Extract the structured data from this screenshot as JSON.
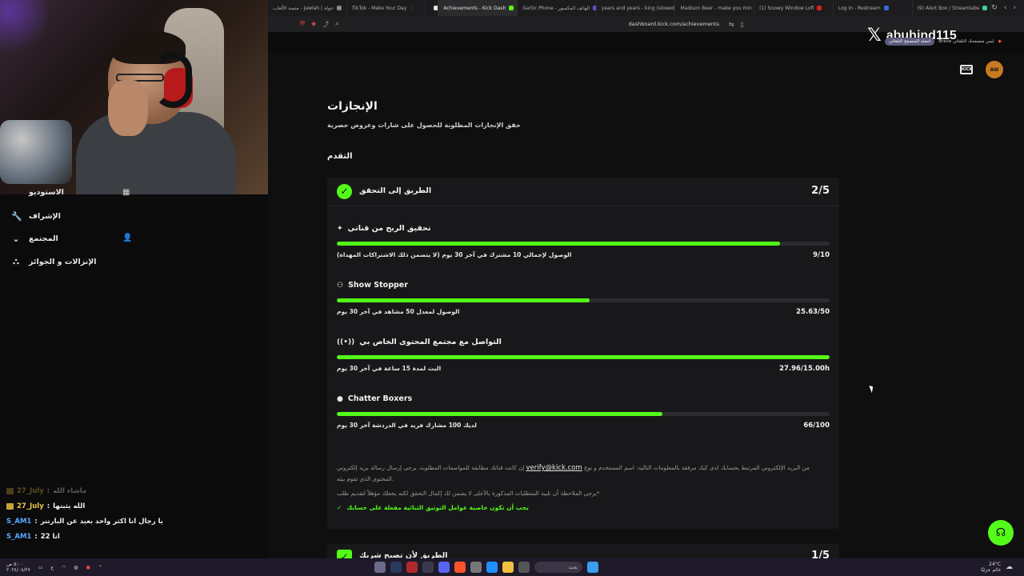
{
  "browser": {
    "tabs": [
      {
        "label": "متصة الألعاب - Jawlah | حولة",
        "color": "#888888"
      },
      {
        "label": "TikTok - Make Your Day",
        "color": "#222222"
      },
      {
        "label": "",
        "color": "#e0e0e0"
      },
      {
        "label": "Achievements - Kick Dash",
        "color": "#53fc18",
        "active": true
      },
      {
        "label": "Gartic Phone - الهاتف المكسور",
        "color": "#6a4ad1"
      },
      {
        "label": "years and years - king (slowed",
        "color": "#e02020"
      },
      {
        "label": "Madison Beer - make you min",
        "color": "#e02020"
      },
      {
        "label": "(1) Snowy Window Lofi",
        "color": "#e02020"
      },
      {
        "label": "Log In - Restream",
        "color": "#3a6ad1"
      },
      {
        "label": "(9) Alert Box / Streamlabs",
        "color": "#3fd1a0"
      }
    ],
    "url": "dashboard.kick.com/achievements"
  },
  "overlay": {
    "x_logo": "𝕏",
    "handle": "abuhind115",
    "brave_text": "Brave ليس متصفحك التلقائي",
    "brave_button": "اجعله المتصفح التلقائي"
  },
  "sidebar": {
    "items": [
      {
        "label": "الاستوديو",
        "icon": "studio-icon"
      },
      {
        "label": "الإشراف",
        "icon": "wrench-icon"
      },
      {
        "label": "المجتمع",
        "icon": "chevron-down-icon"
      },
      {
        "label": "الإنزالات و الجوائز",
        "icon": "drops-icon"
      }
    ]
  },
  "chat": [
    {
      "user": "27_July",
      "message": "ماشاء الله",
      "color": "gold",
      "faded": true
    },
    {
      "user": "27_July",
      "message": "الله يثبتها",
      "color": "gold"
    },
    {
      "user": "S_AM1",
      "message": "يا رجال انا اكثر واحد بعيد عن البارتنر",
      "color": "blue"
    },
    {
      "user": "S_AM1",
      "message": "انا 22",
      "color": "blue"
    }
  ],
  "page": {
    "title": "الإنجازات",
    "subtitle": "حقق الإنجازات المطلوبة للحصول على شارات وعروض حصرية",
    "section": "التقدم"
  },
  "card": {
    "title": "الطريق إلى التحقق",
    "count": "2/5",
    "requirements": [
      {
        "title": "تحقيق الربح من قناتي",
        "icon": "sparkle-icon",
        "desc": "الوصول لإجمالي 10 مشترك في آخر 30 يوم (لا يتضمن ذلك الاشتراكات المهداة)",
        "value": "9/10",
        "progress": 0.9
      },
      {
        "title": "Show Stopper",
        "icon": "viewers-icon",
        "desc": "الوصول لمعدل 50 مشاهد في آخر 30 يوم",
        "value": "25.63/50",
        "progress": 0.513
      },
      {
        "title": "التواصل مع مجتمع المحتوى الخاص بي",
        "icon": "broadcast-icon",
        "desc": "البث لمدة 15 ساعة في آخر 30 يوم",
        "value": "27.96/15.00h",
        "progress": 1.0
      },
      {
        "title": "Chatter Boxers",
        "icon": "chat-bubble-icon",
        "desc": "لديك 100 مشارك فريد في الدردشة آخر 30 يوم",
        "value": "66/100",
        "progress": 0.66
      }
    ],
    "note_1a": "إن كانت قناتك مطابقة للمواصفات المطلوبة، يرجى إرسال رسالة بريد إلكتروني",
    "note_email": "verify@kick.com",
    "note_1b": "من البريد الإلكتروني المرتبط بحسابك لدى كيك مرفقة بالمعلومات التالية: اسم المستخدم و نوع المحتوى الذي تقوم ببثه.",
    "note_2": "يرجى الملاحظة أن تلبية المتطلبات المذكورة بالأعلى لا يضمن لك إكمال التحقق لكنه يجعلك مؤهلاً لتقديم طلب*",
    "note_ok": "يجب أن تكون خاصية عوامل التوثيق الثنائية مفعلة على حسابك"
  },
  "card2": {
    "title": "الطريق لأن تصبح شريك",
    "count": "1/5"
  },
  "top_icons": {
    "box_label": "KICK",
    "avatar_label": "AW"
  },
  "taskbar": {
    "search": "بحث",
    "weather": "24°C",
    "weather_desc": "غائم جزئيًا",
    "time": "٥:٠٠ ص",
    "date": "٢٠٢٤/٠٨/٢٧",
    "lang": "ع"
  }
}
